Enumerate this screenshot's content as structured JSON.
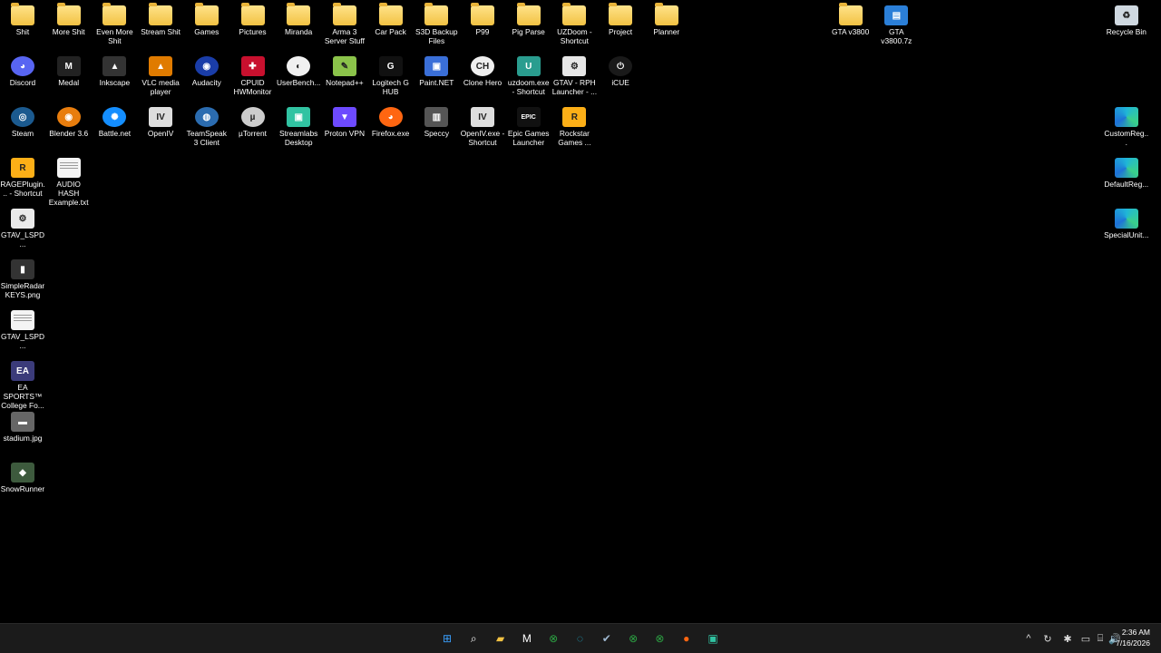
{
  "desktop_icons": [
    {
      "label": "Shit",
      "icon": "folder-icon",
      "kind": "folder",
      "col": 0,
      "row": 0
    },
    {
      "label": "More Shit",
      "icon": "folder-icon",
      "kind": "folder",
      "col": 1,
      "row": 0
    },
    {
      "label": "Even More Shit",
      "icon": "folder-icon",
      "kind": "folder",
      "col": 2,
      "row": 0
    },
    {
      "label": "Stream Shit",
      "icon": "folder-icon",
      "kind": "folder",
      "col": 3,
      "row": 0
    },
    {
      "label": "Games",
      "icon": "folder-icon",
      "kind": "folder",
      "col": 4,
      "row": 0
    },
    {
      "label": "Pictures",
      "icon": "folder-icon",
      "kind": "folder",
      "col": 5,
      "row": 0
    },
    {
      "label": "Miranda",
      "icon": "folder-icon",
      "kind": "folder",
      "col": 6,
      "row": 0
    },
    {
      "label": "Arma 3 Server Stuff",
      "icon": "folder-icon",
      "kind": "folder",
      "col": 7,
      "row": 0
    },
    {
      "label": "Car Pack",
      "icon": "folder-icon",
      "kind": "folder",
      "col": 8,
      "row": 0
    },
    {
      "label": "S3D Backup Files",
      "icon": "folder-icon",
      "kind": "folder",
      "col": 9,
      "row": 0
    },
    {
      "label": "P99",
      "icon": "folder-icon",
      "kind": "folder",
      "col": 10,
      "row": 0
    },
    {
      "label": "Pig Parse",
      "icon": "folder-icon",
      "kind": "folder",
      "col": 11,
      "row": 0
    },
    {
      "label": "UZDoom - Shortcut",
      "icon": "folder-shortcut-icon",
      "kind": "folder",
      "col": 12,
      "row": 0
    },
    {
      "label": "Project",
      "icon": "folder-icon",
      "kind": "folder",
      "col": 13,
      "row": 0
    },
    {
      "label": "Planner",
      "icon": "folder-icon",
      "kind": "folder",
      "col": 14,
      "row": 0
    },
    {
      "label": "GTA v3800",
      "icon": "folder-icon",
      "kind": "folder",
      "col": 18,
      "row": 0
    },
    {
      "label": "GTA v3800.7z",
      "icon": "archive-icon",
      "kind": "app",
      "color": "#2b7fd8",
      "glyph": "▤",
      "col": 19,
      "row": 0
    },
    {
      "label": "Recycle Bin",
      "icon": "recycle-bin-icon",
      "kind": "app",
      "color": "#cfd8e0",
      "glyph": "♻",
      "col": 24,
      "row": 0
    },
    {
      "label": "Discord",
      "icon": "discord-icon",
      "kind": "round",
      "color": "#5865f2",
      "glyph": "◕",
      "col": 0,
      "row": 1
    },
    {
      "label": "Medal",
      "icon": "medal-icon",
      "kind": "app",
      "color": "#222",
      "glyph": "M",
      "col": 1,
      "row": 1
    },
    {
      "label": "Inkscape",
      "icon": "inkscape-icon",
      "kind": "app",
      "color": "#333",
      "glyph": "▲",
      "col": 2,
      "row": 1
    },
    {
      "label": "VLC media player",
      "icon": "vlc-icon",
      "kind": "app",
      "color": "#e07b00",
      "glyph": "▲",
      "col": 3,
      "row": 1
    },
    {
      "label": "Audacity",
      "icon": "audacity-icon",
      "kind": "round",
      "color": "#1a3da8",
      "glyph": "◉",
      "col": 4,
      "row": 1
    },
    {
      "label": "CPUID HWMonitor",
      "icon": "hwmonitor-icon",
      "kind": "app",
      "color": "#c8102e",
      "glyph": "✚",
      "col": 5,
      "row": 1
    },
    {
      "label": "UserBench...",
      "icon": "userbenchmark-icon",
      "kind": "round",
      "color": "#f0f0f0",
      "glyph": "◐",
      "col": 6,
      "row": 1
    },
    {
      "label": "Notepad++",
      "icon": "notepadpp-icon",
      "kind": "app",
      "color": "#8bc34a",
      "glyph": "✎",
      "col": 7,
      "row": 1
    },
    {
      "label": "Logitech G HUB",
      "icon": "logitech-icon",
      "kind": "app",
      "color": "#111",
      "glyph": "G",
      "col": 8,
      "row": 1
    },
    {
      "label": "Paint.NET",
      "icon": "paintnet-icon",
      "kind": "app",
      "color": "#3a6fd8",
      "glyph": "▣",
      "col": 9,
      "row": 1
    },
    {
      "label": "Clone Hero",
      "icon": "clonehero-icon",
      "kind": "round",
      "color": "#eee",
      "glyph": "CH",
      "col": 10,
      "row": 1
    },
    {
      "label": "uzdoom.exe - Shortcut",
      "icon": "uzdoom-icon",
      "kind": "app",
      "color": "#2a9d8f",
      "glyph": "U",
      "col": 11,
      "row": 1
    },
    {
      "label": "GTAV - RPH Launcher - ...",
      "icon": "rph-launcher-icon",
      "kind": "app",
      "color": "#e6e6e6",
      "glyph": "⚙",
      "col": 12,
      "row": 1
    },
    {
      "label": "iCUE",
      "icon": "icue-icon",
      "kind": "round",
      "color": "#1a1a1a",
      "glyph": "⏻",
      "col": 13,
      "row": 1
    },
    {
      "label": "Steam",
      "icon": "steam-icon",
      "kind": "round",
      "color": "#1b5a8f",
      "glyph": "◎",
      "col": 0,
      "row": 2
    },
    {
      "label": "Blender 3.6",
      "icon": "blender-icon",
      "kind": "round",
      "color": "#e87d0d",
      "glyph": "◉",
      "col": 1,
      "row": 2
    },
    {
      "label": "Battle.net",
      "icon": "battlenet-icon",
      "kind": "round",
      "color": "#148eff",
      "glyph": "✺",
      "col": 2,
      "row": 2
    },
    {
      "label": "OpenIV",
      "icon": "openiv-icon",
      "kind": "app",
      "color": "#ddd",
      "glyph": "IV",
      "col": 3,
      "row": 2
    },
    {
      "label": "TeamSpeak 3 Client",
      "icon": "teamspeak-icon",
      "kind": "round",
      "color": "#2b6cb0",
      "glyph": "◍",
      "col": 4,
      "row": 2
    },
    {
      "label": "µTorrent",
      "icon": "utorrent-icon",
      "kind": "round",
      "color": "#ccc",
      "glyph": "µ",
      "col": 5,
      "row": 2
    },
    {
      "label": "Streamlabs Desktop",
      "icon": "streamlabs-icon",
      "kind": "app",
      "color": "#31c3a2",
      "glyph": "▣",
      "col": 6,
      "row": 2
    },
    {
      "label": "Proton VPN",
      "icon": "protonvpn-icon",
      "kind": "app",
      "color": "#6d4aff",
      "glyph": "▼",
      "col": 7,
      "row": 2
    },
    {
      "label": "Firefox.exe",
      "icon": "firefox-icon",
      "kind": "round",
      "color": "#ff6611",
      "glyph": "◕",
      "col": 8,
      "row": 2
    },
    {
      "label": "Speccy",
      "icon": "speccy-icon",
      "kind": "app",
      "color": "#555",
      "glyph": "▥",
      "col": 9,
      "row": 2
    },
    {
      "label": "OpenIV.exe - Shortcut",
      "icon": "openiv-shortcut-icon",
      "kind": "app",
      "color": "#ddd",
      "glyph": "IV",
      "col": 10,
      "row": 2
    },
    {
      "label": "Epic Games Launcher",
      "icon": "epic-games-icon",
      "kind": "app",
      "color": "#111",
      "glyph": "EPIC",
      "col": 11,
      "row": 2
    },
    {
      "label": "Rockstar Games ...",
      "icon": "rockstar-icon",
      "kind": "app",
      "color": "#fcaf17",
      "glyph": "R",
      "col": 12,
      "row": 2
    },
    {
      "label": "CustomReg...",
      "icon": "edge-icon",
      "kind": "edge",
      "col": 24,
      "row": 2
    },
    {
      "label": "RAGEPlugin... - Shortcut",
      "icon": "rageplugin-icon",
      "kind": "app",
      "color": "#fcaf17",
      "glyph": "R",
      "col": 0,
      "row": 3
    },
    {
      "label": "AUDIO HASH Example.txt",
      "icon": "text-file-icon",
      "kind": "doc",
      "col": 1,
      "row": 3
    },
    {
      "label": "DefaultReg...",
      "icon": "edge-icon",
      "kind": "edge",
      "col": 24,
      "row": 3
    },
    {
      "label": "GTAV_LSPD...",
      "icon": "image-file-icon",
      "kind": "app",
      "color": "#eaeaea",
      "glyph": "⚙",
      "col": 0,
      "row": 4
    },
    {
      "label": "SpecialUnit...",
      "icon": "edge-icon",
      "kind": "edge",
      "col": 24,
      "row": 4
    },
    {
      "label": "SimpleRadar KEYS.png",
      "icon": "png-file-icon",
      "kind": "app",
      "color": "#333",
      "glyph": "▮",
      "col": 0,
      "row": 5
    },
    {
      "label": "GTAV_LSPD...",
      "icon": "text-file-icon",
      "kind": "doc",
      "col": 0,
      "row": 6
    },
    {
      "label": "EA SPORTS™ College Fo...",
      "icon": "ea-sports-icon",
      "kind": "app",
      "color": "#3b3b7a",
      "glyph": "EA",
      "col": 0,
      "row": 7
    },
    {
      "label": "stadium.jpg",
      "icon": "jpg-file-icon",
      "kind": "app",
      "color": "#666",
      "glyph": "▬",
      "col": 0,
      "row": 8
    },
    {
      "label": "SnowRunner",
      "icon": "snowrunner-icon",
      "kind": "app",
      "color": "#3d5a3d",
      "glyph": "◆",
      "col": 0,
      "row": 9
    }
  ],
  "taskbar": {
    "apps": [
      {
        "name": "start-button",
        "icon": "windows-start-icon",
        "glyph": "⊞",
        "color": "#3aa0ff"
      },
      {
        "name": "search-button",
        "icon": "search-icon",
        "glyph": "⌕",
        "color": "#fff"
      },
      {
        "name": "file-explorer-button",
        "icon": "file-explorer-icon",
        "glyph": "▰",
        "color": "#f2c243"
      },
      {
        "name": "medal-taskbar-button",
        "icon": "medal-icon",
        "glyph": "M",
        "color": "#fff"
      },
      {
        "name": "xbox-taskbar-button",
        "icon": "xbox-icon",
        "glyph": "⊗",
        "color": "#2ca243"
      },
      {
        "name": "edge-taskbar-button",
        "icon": "edge-icon",
        "glyph": "◌",
        "color": "#1fb6d8"
      },
      {
        "name": "steam-taskbar-button",
        "icon": "steam-icon",
        "glyph": "✔",
        "color": "#9fb8d0"
      },
      {
        "name": "xbox-app-taskbar-button",
        "icon": "xbox-app-icon",
        "glyph": "⊗",
        "color": "#2ca243"
      },
      {
        "name": "xbox-game-bar-taskbar-button",
        "icon": "xbox-game-bar-icon",
        "glyph": "⊗",
        "color": "#2ca243"
      },
      {
        "name": "firefox-taskbar-button",
        "icon": "firefox-icon",
        "glyph": "●",
        "color": "#ff6611"
      },
      {
        "name": "streamlabs-taskbar-button",
        "icon": "streamlabs-icon",
        "glyph": "▣",
        "color": "#31c3a2"
      }
    ],
    "tray": [
      {
        "name": "show-hidden-icons",
        "icon": "chevron-up-icon",
        "glyph": "^"
      },
      {
        "name": "sync-tray-icon",
        "icon": "sync-icon",
        "glyph": "↻"
      },
      {
        "name": "bluetooth-tray-icon",
        "icon": "bluetooth-icon",
        "glyph": "✱"
      },
      {
        "name": "display-tray-icon",
        "icon": "display-icon",
        "glyph": "▭"
      },
      {
        "name": "network-tray-icon",
        "icon": "network-icon",
        "glyph": "⌸"
      },
      {
        "name": "volume-tray-icon",
        "icon": "volume-icon",
        "glyph": "🔊"
      }
    ],
    "time": "2:36 AM",
    "date": "7/16/2026"
  }
}
